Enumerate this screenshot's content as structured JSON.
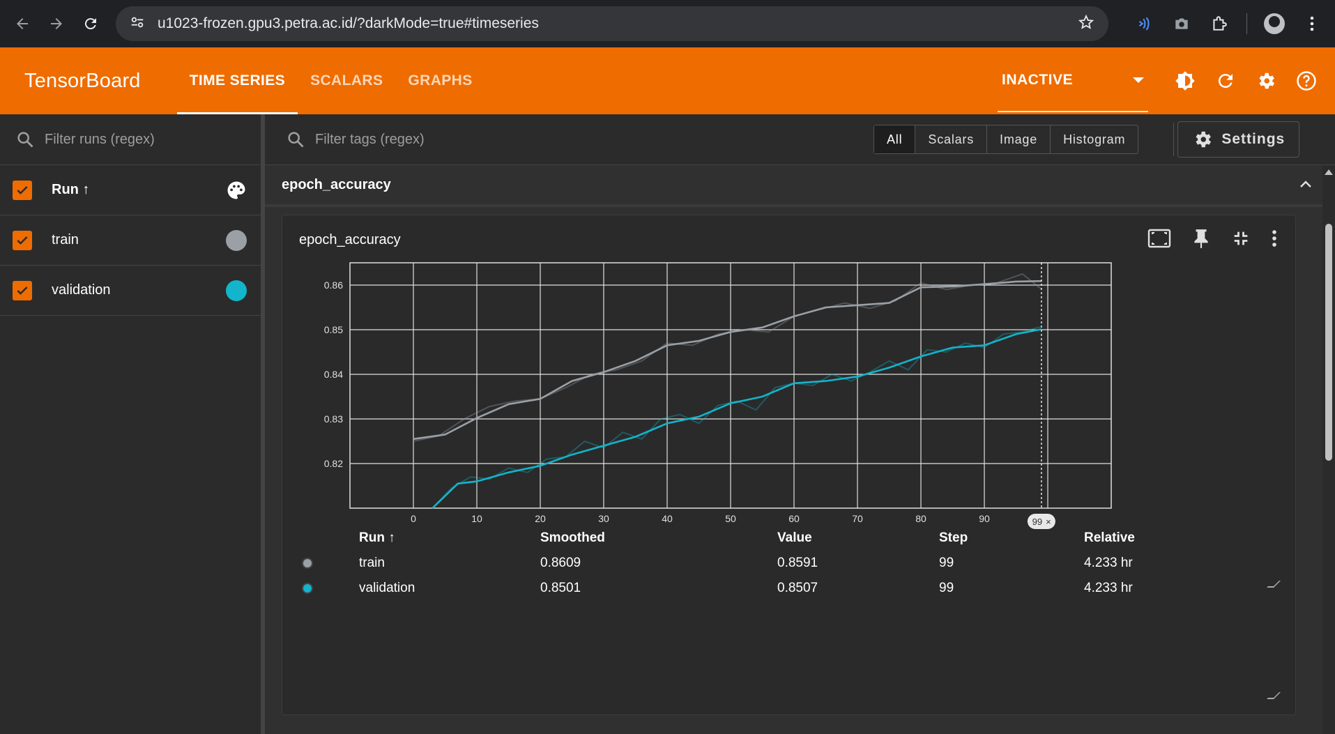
{
  "browser": {
    "url": "u1023-frozen.gpu3.petra.ac.id/?darkMode=true#timeseries"
  },
  "header": {
    "brand": "TensorBoard",
    "tabs": [
      {
        "label": "TIME SERIES",
        "active": true
      },
      {
        "label": "SCALARS",
        "active": false
      },
      {
        "label": "GRAPHS",
        "active": false
      }
    ],
    "reload_status": "INACTIVE"
  },
  "sidebar": {
    "filter_placeholder": "Filter runs (regex)",
    "run_header": "Run ↑",
    "runs": [
      {
        "name": "train",
        "color": "#9aa0a6",
        "checked": true
      },
      {
        "name": "validation",
        "color": "#12b5cb",
        "checked": true
      }
    ]
  },
  "toolbar": {
    "filter_placeholder": "Filter tags (regex)",
    "types": [
      "All",
      "Scalars",
      "Image",
      "Histogram"
    ],
    "active_type": "All",
    "settings_label": "Settings"
  },
  "group": {
    "title": "epoch_accuracy"
  },
  "card": {
    "title": "epoch_accuracy",
    "step_badge": "99"
  },
  "legend": {
    "headers": {
      "run": "Run ↑",
      "smoothed": "Smoothed",
      "value": "Value",
      "step": "Step",
      "relative": "Relative"
    },
    "rows": [
      {
        "run": "train",
        "color": "#9aa0a6",
        "smoothed": "0.8609",
        "value": "0.8591",
        "step": "99",
        "relative": "4.233 hr"
      },
      {
        "run": "validation",
        "color": "#12b5cb",
        "smoothed": "0.8501",
        "value": "0.8507",
        "step": "99",
        "relative": "4.233 hr"
      }
    ]
  },
  "chart_data": {
    "type": "line",
    "title": "epoch_accuracy",
    "xlabel": "",
    "ylabel": "",
    "xlim": [
      -10,
      110
    ],
    "ylim": [
      0.81,
      0.865
    ],
    "x_ticks": [
      0,
      10,
      20,
      30,
      40,
      50,
      60,
      70,
      80,
      90
    ],
    "y_ticks": [
      0.82,
      0.83,
      0.84,
      0.85,
      0.86
    ],
    "cursor_step": 99,
    "grid": true,
    "series": [
      {
        "name": "train",
        "color": "#9aa0a6",
        "smoothed": [
          [
            0,
            0.8255
          ],
          [
            5,
            0.8265
          ],
          [
            10,
            0.8302
          ],
          [
            15,
            0.8333
          ],
          [
            20,
            0.8345
          ],
          [
            25,
            0.8385
          ],
          [
            30,
            0.8405
          ],
          [
            35,
            0.843
          ],
          [
            40,
            0.8465
          ],
          [
            45,
            0.8475
          ],
          [
            50,
            0.8495
          ],
          [
            55,
            0.8505
          ],
          [
            60,
            0.853
          ],
          [
            65,
            0.855
          ],
          [
            70,
            0.8555
          ],
          [
            75,
            0.856
          ],
          [
            80,
            0.8595
          ],
          [
            85,
            0.8597
          ],
          [
            90,
            0.8602
          ],
          [
            95,
            0.8608
          ],
          [
            99,
            0.8609
          ]
        ],
        "raw": [
          [
            0,
            0.825
          ],
          [
            4,
            0.8262
          ],
          [
            8,
            0.83
          ],
          [
            12,
            0.8328
          ],
          [
            16,
            0.834
          ],
          [
            20,
            0.8345
          ],
          [
            24,
            0.837
          ],
          [
            28,
            0.84
          ],
          [
            32,
            0.841
          ],
          [
            36,
            0.843
          ],
          [
            40,
            0.847
          ],
          [
            44,
            0.8465
          ],
          [
            48,
            0.849
          ],
          [
            52,
            0.85
          ],
          [
            56,
            0.8495
          ],
          [
            60,
            0.853
          ],
          [
            64,
            0.8545
          ],
          [
            68,
            0.856
          ],
          [
            72,
            0.8548
          ],
          [
            76,
            0.8565
          ],
          [
            80,
            0.8605
          ],
          [
            84,
            0.859
          ],
          [
            88,
            0.86
          ],
          [
            92,
            0.8605
          ],
          [
            96,
            0.8625
          ],
          [
            99,
            0.8591
          ]
        ]
      },
      {
        "name": "validation",
        "color": "#12b5cb",
        "smoothed": [
          [
            3,
            0.81
          ],
          [
            7,
            0.8155
          ],
          [
            10,
            0.816
          ],
          [
            15,
            0.818
          ],
          [
            20,
            0.8195
          ],
          [
            25,
            0.822
          ],
          [
            30,
            0.824
          ],
          [
            35,
            0.826
          ],
          [
            40,
            0.829
          ],
          [
            45,
            0.8305
          ],
          [
            50,
            0.8335
          ],
          [
            55,
            0.835
          ],
          [
            60,
            0.838
          ],
          [
            65,
            0.8385
          ],
          [
            70,
            0.8395
          ],
          [
            75,
            0.8415
          ],
          [
            80,
            0.844
          ],
          [
            85,
            0.846
          ],
          [
            90,
            0.8465
          ],
          [
            95,
            0.849
          ],
          [
            99,
            0.8501
          ]
        ],
        "raw": [
          [
            3,
            0.81
          ],
          [
            6,
            0.8145
          ],
          [
            9,
            0.817
          ],
          [
            12,
            0.8165
          ],
          [
            15,
            0.819
          ],
          [
            18,
            0.818
          ],
          [
            21,
            0.821
          ],
          [
            24,
            0.8215
          ],
          [
            27,
            0.825
          ],
          [
            30,
            0.8235
          ],
          [
            33,
            0.827
          ],
          [
            36,
            0.8255
          ],
          [
            39,
            0.83
          ],
          [
            42,
            0.831
          ],
          [
            45,
            0.829
          ],
          [
            48,
            0.833
          ],
          [
            51,
            0.834
          ],
          [
            54,
            0.832
          ],
          [
            57,
            0.837
          ],
          [
            60,
            0.838
          ],
          [
            63,
            0.8375
          ],
          [
            66,
            0.84
          ],
          [
            69,
            0.8385
          ],
          [
            72,
            0.8405
          ],
          [
            75,
            0.843
          ],
          [
            78,
            0.841
          ],
          [
            81,
            0.8455
          ],
          [
            84,
            0.845
          ],
          [
            87,
            0.847
          ],
          [
            90,
            0.846
          ],
          [
            93,
            0.849
          ],
          [
            96,
            0.8495
          ],
          [
            99,
            0.8507
          ]
        ]
      }
    ]
  }
}
